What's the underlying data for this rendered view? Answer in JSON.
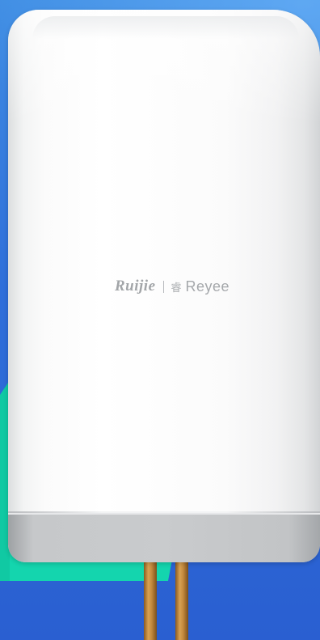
{
  "scene": {
    "description_colors": {
      "background_top": "#3f8de3",
      "background_bottom": "#2a5fd1",
      "accent_teal": "#17d6b0",
      "device_white": "#f7f7f8",
      "device_base": "#c7c9cb",
      "cable_copper": "#c99042"
    }
  },
  "brand": {
    "primary": "Ruijie",
    "mark": "睿",
    "secondary": "Reyee"
  }
}
